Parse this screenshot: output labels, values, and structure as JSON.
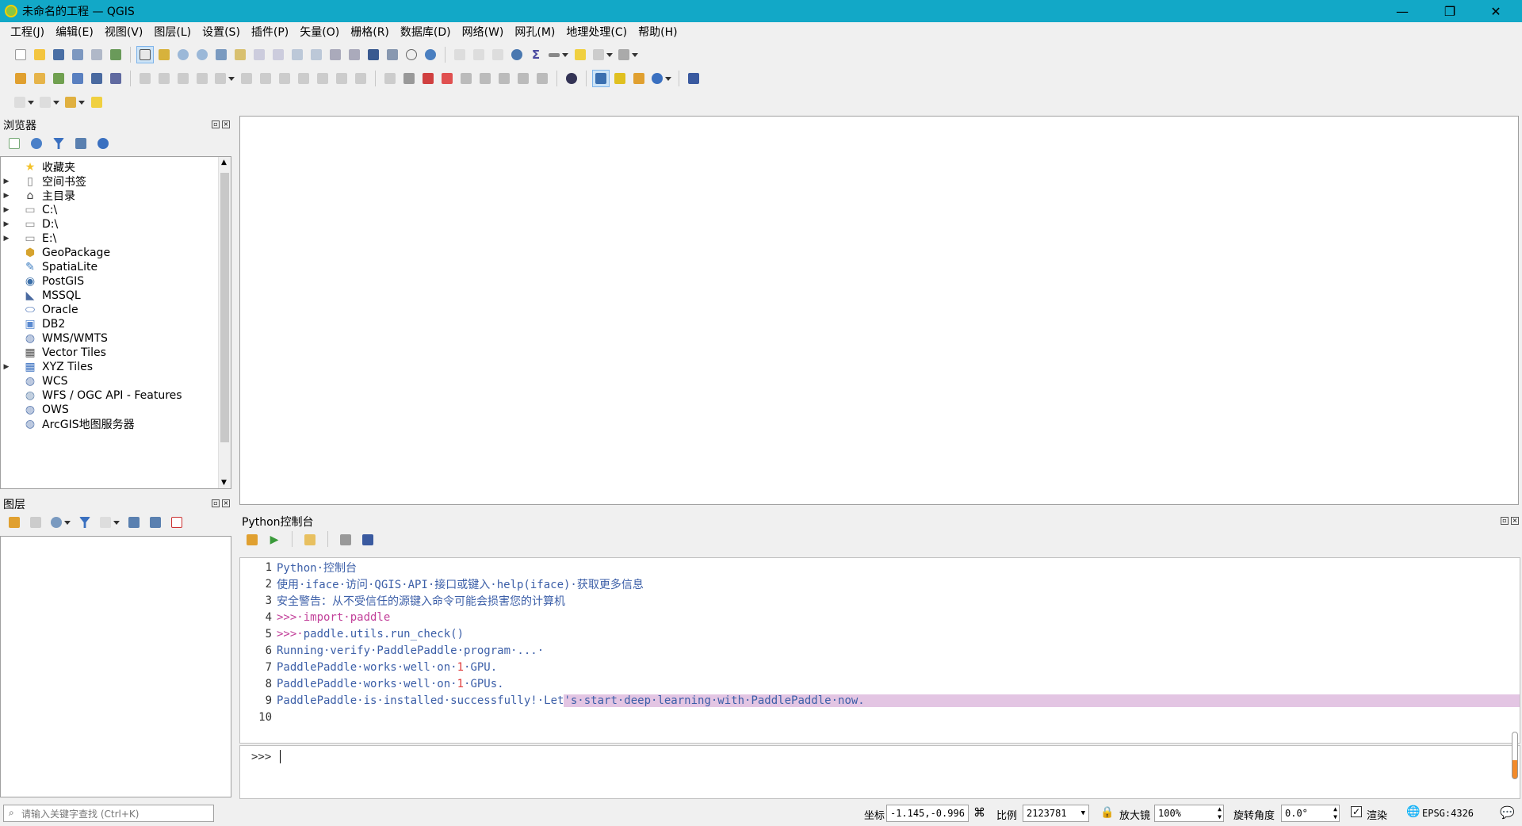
{
  "window": {
    "title": "未命名的工程 — QGIS",
    "minimize": "—",
    "restore": "❐",
    "close": "✕"
  },
  "menu": [
    "工程(J)",
    "编辑(E)",
    "视图(V)",
    "图层(L)",
    "设置(S)",
    "插件(P)",
    "矢量(O)",
    "栅格(R)",
    "数据库(D)",
    "网络(W)",
    "网孔(M)",
    "地理处理(C)",
    "帮助(H)"
  ],
  "browser": {
    "title": "浏览器",
    "items": [
      {
        "label": "收藏夹",
        "icon": "star-icon",
        "expandable": false
      },
      {
        "label": "空间书签",
        "icon": "bookmark-icon",
        "expandable": true
      },
      {
        "label": "主目录",
        "icon": "home-icon",
        "expandable": true
      },
      {
        "label": "C:\\",
        "icon": "folder-icon",
        "expandable": true
      },
      {
        "label": "D:\\",
        "icon": "folder-icon",
        "expandable": true
      },
      {
        "label": "E:\\",
        "icon": "folder-icon",
        "expandable": true
      },
      {
        "label": "GeoPackage",
        "icon": "geopackage-icon",
        "expandable": false
      },
      {
        "label": "SpatiaLite",
        "icon": "spatialite-icon",
        "expandable": false
      },
      {
        "label": "PostGIS",
        "icon": "postgis-icon",
        "expandable": false
      },
      {
        "label": "MSSQL",
        "icon": "mssql-icon",
        "expandable": false
      },
      {
        "label": "Oracle",
        "icon": "oracle-icon",
        "expandable": false
      },
      {
        "label": "DB2",
        "icon": "db2-icon",
        "expandable": false
      },
      {
        "label": "WMS/WMTS",
        "icon": "globe-icon",
        "expandable": false
      },
      {
        "label": "Vector Tiles",
        "icon": "grid-icon",
        "expandable": false
      },
      {
        "label": "XYZ Tiles",
        "icon": "tiles-icon",
        "expandable": true
      },
      {
        "label": "WCS",
        "icon": "globe-icon",
        "expandable": false
      },
      {
        "label": "WFS / OGC API - Features",
        "icon": "wfs-icon",
        "expandable": false
      },
      {
        "label": "OWS",
        "icon": "globe-icon",
        "expandable": false
      },
      {
        "label": "ArcGIS地图服务器",
        "icon": "globe-icon",
        "expandable": false
      }
    ]
  },
  "layers": {
    "title": "图层"
  },
  "console": {
    "title": "Python控制台",
    "lines": [
      {
        "n": "1",
        "segments": [
          {
            "t": "Python·控制台",
            "c": ""
          }
        ]
      },
      {
        "n": "2",
        "segments": [
          {
            "t": "使用·iface·访问·QGIS·API·接口或键入·help(iface)·获取更多信息",
            "c": ""
          }
        ]
      },
      {
        "n": "3",
        "segments": [
          {
            "t": "安全警告：从不受信任的源键入命令可能会损害您的计算机",
            "c": ""
          }
        ]
      },
      {
        "n": "4",
        "segments": [
          {
            "t": ">>>·import·paddle",
            "c": "prompt"
          }
        ]
      },
      {
        "n": "5",
        "segments": [
          {
            "t": ">>>·",
            "c": "prompt"
          },
          {
            "t": "paddle.utils.run_check()",
            "c": ""
          }
        ]
      },
      {
        "n": "6",
        "segments": [
          {
            "t": "Running·verify·PaddlePaddle·program·...·",
            "c": ""
          }
        ]
      },
      {
        "n": "7",
        "segments": [
          {
            "t": "PaddlePaddle·works·well·on·",
            "c": ""
          },
          {
            "t": "1",
            "c": "num"
          },
          {
            "t": "·GPU.",
            "c": ""
          }
        ]
      },
      {
        "n": "8",
        "segments": [
          {
            "t": "PaddlePaddle·works·well·on·",
            "c": ""
          },
          {
            "t": "1",
            "c": "num"
          },
          {
            "t": "·GPUs.",
            "c": ""
          }
        ]
      },
      {
        "n": "9",
        "segments": [
          {
            "t": "PaddlePaddle·is·installed·successfully!·Let",
            "c": ""
          },
          {
            "t": "'s·start·deep·learning·with·PaddlePaddle·now.",
            "c": "hl"
          }
        ]
      },
      {
        "n": "10",
        "segments": []
      }
    ],
    "input_prompt": ">>>"
  },
  "status": {
    "search_placeholder": "请输入关键字查找 (Ctrl+K)",
    "coord_label": "坐标",
    "coord_value": "-1.145,-0.996",
    "scale_label": "比例",
    "scale_value": "2123781",
    "magnifier_label": "放大镜",
    "magnifier_value": "100%",
    "rotation_label": "旋转角度",
    "rotation_value": "0.0°",
    "render_label": "渲染",
    "crs": "EPSG:4326"
  }
}
